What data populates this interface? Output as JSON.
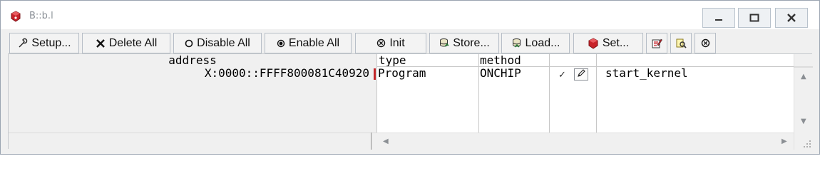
{
  "window": {
    "title": "B::b.l"
  },
  "toolbar": {
    "setup_label": "Setup...",
    "delete_all_label": "Delete All",
    "disable_all_label": "Disable All",
    "enable_all_label": "Enable All",
    "init_label": "Init",
    "store_label": "Store...",
    "load_label": "Load...",
    "set_label": "Set..."
  },
  "columns": {
    "address": "address",
    "type": "type",
    "method": "method"
  },
  "rows": [
    {
      "address": "X:0000::FFFF800081C40920",
      "type": "Program",
      "method": "ONCHIP",
      "check": "✓",
      "name": "start_kernel"
    }
  ],
  "colors": {
    "marker": "#c0262a",
    "accent_red": "#cc1f24",
    "title_text": "#8a8f96"
  }
}
